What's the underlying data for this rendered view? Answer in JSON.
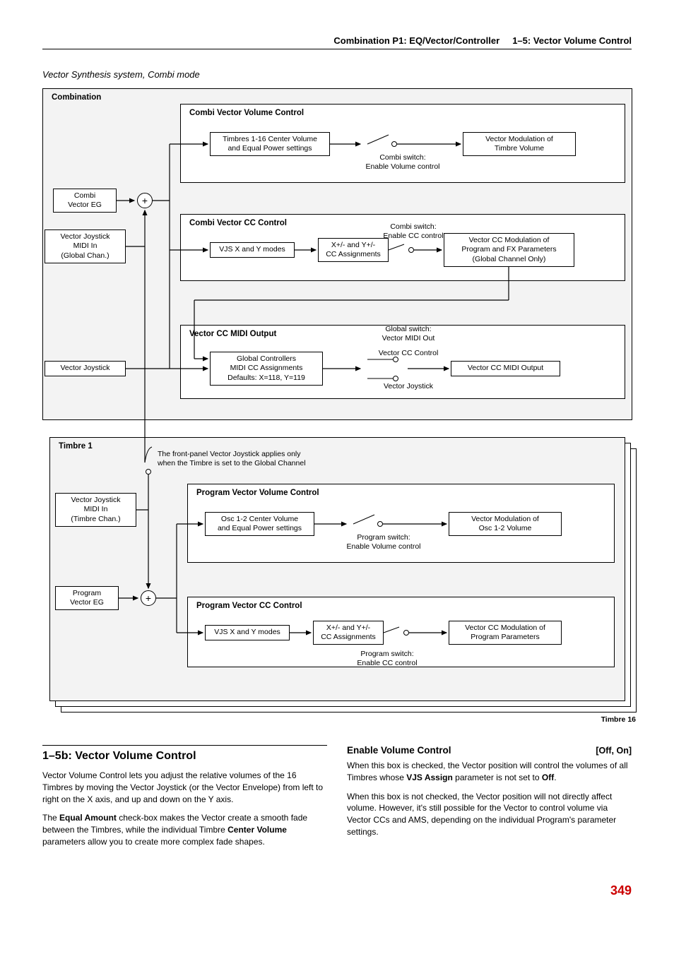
{
  "header": {
    "left": "Combination P1: EQ/Vector/Controller",
    "right": "1–5: Vector Volume Control"
  },
  "caption": "Vector Synthesis system, Combi mode",
  "diagram": {
    "outer_label": "Combination",
    "combi_vec_eg": "Combi\nVector EG",
    "vjs_midi_global": "Vector Joystick\nMIDI In\n(Global Chan.)",
    "vjs_label": "Vector Joystick",
    "group_vol_title": "Combi Vector Volume Control",
    "vol_box1": "Timbres 1-16 Center Volume\nand Equal Power settings",
    "vol_sw": "Combi switch:\nEnable Volume control",
    "vol_out": "Vector Modulation of\nTimbre Volume",
    "group_cc_title": "Combi Vector CC Control",
    "cc_box1": "VJS X and Y modes",
    "cc_box2": "X+/- and Y+/-\nCC Assignments",
    "cc_sw": "Combi switch:\nEnable CC control",
    "cc_out": "Vector CC Modulation of\nProgram and FX Parameters\n(Global Channel Only)",
    "group_midi_title": "Vector CC MIDI Output",
    "midi_box1": "Global Controllers\nMIDI CC Assignments\nDefaults: X=118, Y=119",
    "midi_sw1": "Global switch:\nVector MIDI Out",
    "midi_sw2a": "Vector CC Control",
    "midi_sw2b": "Vector Joystick",
    "midi_out": "Vector CC MIDI Output",
    "timbre1": "Timbre 1",
    "timbre_note": "The front-panel Vector Joystick applies only\nwhen the Timbre is set to the Global Channel",
    "t_vjs_midi": "Vector Joystick\nMIDI In\n(Timbre Chan.)",
    "prog_vec_eg": "Program\nVector EG",
    "group_pvol_title": "Program Vector Volume Control",
    "pvol_box1": "Osc 1-2 Center Volume\nand Equal Power settings",
    "pvol_sw": "Program switch:\nEnable Volume control",
    "pvol_out": "Vector Modulation of\nOsc 1-2 Volume",
    "group_pcc_title": "Program Vector CC Control",
    "pcc_box1": "VJS X and Y modes",
    "pcc_box2": "X+/- and Y+/-\nCC Assignments",
    "pcc_sw": "Program switch:\nEnable CC control",
    "pcc_out": "Vector CC Modulation of\nProgram Parameters",
    "timbre16": "Timbre 16"
  },
  "section": {
    "title": "1–5b: Vector Volume Control",
    "p1a": "Vector Volume Control lets you adjust the relative volumes of the 16 Timbres by moving the Vector Joystick (or the Vector Envelope) from left to right on the X axis, and up and down on the Y axis.",
    "p1b_pre": "The ",
    "p1b_b1": "Equal Amount",
    "p1b_mid": " check-box makes the Vector create a smooth fade between the Timbres, while the individual Timbre ",
    "p1b_b2": "Center Volume",
    "p1b_post": " parameters allow you to create more complex fade shapes.",
    "p2_title": "Enable Volume Control",
    "p2_opt": "[Off, On]",
    "p2a_pre": "When this box is checked, the Vector position will control the volumes of all Timbres whose ",
    "p2a_b1": "VJS Assign",
    "p2a_mid": " parameter is not set to ",
    "p2a_b2": "Off",
    "p2a_post": ".",
    "p2b": "When this box is not checked, the Vector position will not directly affect volume. However, it's still possible for the Vector to control volume via Vector CCs and AMS, depending on the individual Program's parameter settings."
  },
  "page": "349"
}
